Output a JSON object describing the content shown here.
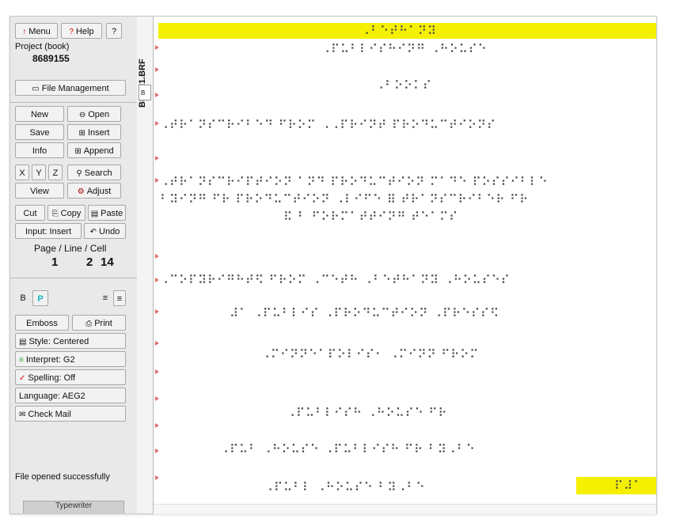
{
  "panel": {
    "menu_label": "Menu",
    "help_label": "Help",
    "question_label": "?",
    "project_label": "Project (book)",
    "project_number": "8689155",
    "file_management_label": "File Management",
    "new_label": "New",
    "open_label": "Open",
    "save_label": "Save",
    "insert_label": "Insert",
    "info_label": "Info",
    "append_label": "Append",
    "x_label": "X",
    "y_label": "Y",
    "z_label": "Z",
    "search_label": "Search",
    "view_label": "View",
    "adjust_label": "Adjust",
    "cut_label": "Cut",
    "copy_label": "Copy",
    "paste_label": "Paste",
    "input_label": "Input: Insert",
    "undo_label": "Undo",
    "position_label": "Page / Line / Cell",
    "page": "1",
    "line": "2",
    "cell": "14",
    "b_label": "B",
    "p_label": "P",
    "emboss_label": "Emboss",
    "print_label": "Print",
    "style_label": "Style: Centered",
    "interpret_label": "Interpret: G2",
    "spelling_label": "Spelling: Off",
    "language_label": "Language: AEG2",
    "check_mail_label": "Check Mail",
    "status": "File opened successfully",
    "typewriter_label": "Typewriter"
  },
  "tab": {
    "filename": "BETH1.BRF",
    "small": "B"
  },
  "document": {
    "lines": [
      "⠠⠃⠑⠞⠓⠁⠝⠽",
      "⠠⠏⠥⠃⠇⠊⠎⠓⠊⠝⠛ ⠠⠓⠕⠥⠎⠑",
      "⠠⠃⠕⠕⠅⠎",
      "⠠⠞⠗⠁⠝⠎⠉⠗⠊⠃⠑⠙ ⠋⠗⠕⠍ ⠠⠠⠏⠗⠊⠝⠞ ⠏⠗⠕⠙⠥⠉⠞⠊⠕⠝⠎",
      "⠠⠞⠗⠁⠝⠎⠉⠗⠊⠏⠞⠊⠕⠝ ⠁⠝⠙ ⠏⠗⠕⠙⠥⠉⠞⠊⠕⠝ ⠍⠁⠙⠑ ⠏⠕⠎⠎⠊⠃⠇⠑",
      "⠃⠽⠊⠝⠛ ⠋⠗ ⠏⠗⠕⠙⠥⠉⠞⠊⠕⠝ ⠠⠇⠊⠋⠑ ⠿ ⠞⠗⠁⠝⠎⠉⠗⠊⠃⠑⠗ ⠋⠗",
      "⠯ ⠃ ⠋⠕⠗⠍⠁⠞⠞⠊⠝⠛ ⠞⠑⠁⠍⠎",
      "⠠⠉⠕⠏⠽⠗⠊⠛⠓⠞⠫ ⠋⠗⠕⠍ ⠠⠉⠑⠞⠓ ⠠⠃⠑⠞⠓⠁⠝⠽ ⠠⠓⠕⠥⠎⠑⠎",
      "⠼⠁ ⠠⠏⠥⠃⠇⠊⠎ ⠠⠏⠗⠕⠙⠥⠉⠞⠊⠕⠝ ⠠⠏⠗⠑⠎⠎⠫",
      "⠠⠍⠊⠝⠝⠑⠁⠏⠕⠇⠊⠎⠂ ⠠⠍⠊⠝⠝ ⠋⠗⠕⠍",
      "⠠⠏⠥⠃⠇⠊⠎⠓ ⠠⠓⠕⠥⠎⠑ ⠋⠗",
      "⠠⠏⠥⠃ ⠠⠓⠕⠥⠎⠑ ⠠⠏⠥⠃⠇⠊⠎⠓ ⠋⠗ ⠃⠽⠠⠃⠑",
      "⠠⠏⠥⠃⠇ ⠠⠓⠕⠥⠎⠑ ⠃⠽⠠⠃⠑"
    ],
    "page_number": "⠏⠼⠁",
    "highlight_color": "#f5f000",
    "marker_color": "#e07070"
  }
}
